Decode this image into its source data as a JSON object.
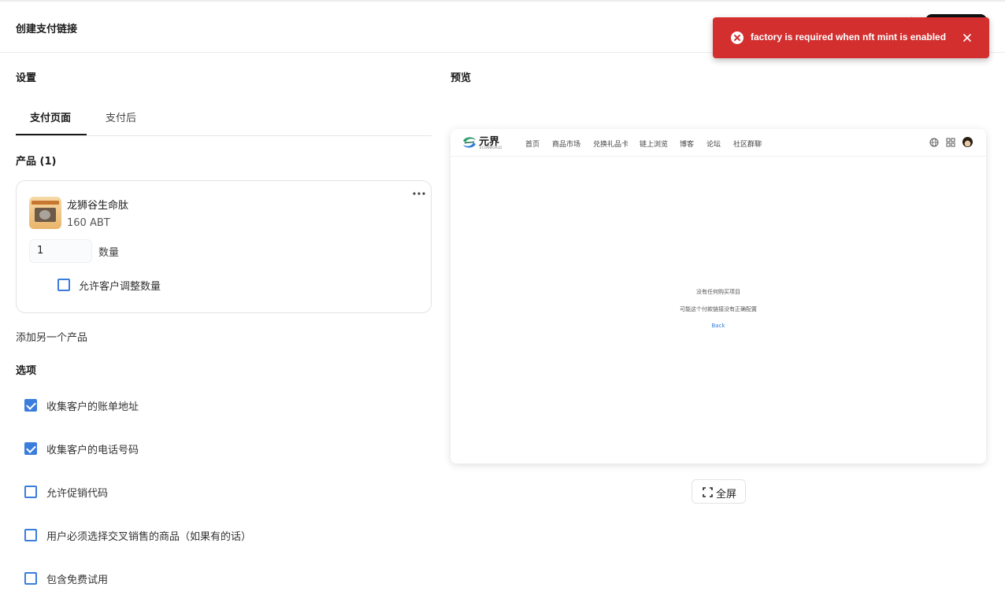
{
  "header": {
    "title": "创建支付链接"
  },
  "toast": {
    "message": "factory is required when nft mint is enabled",
    "color": "#d32f2f"
  },
  "settings": {
    "title": "设置",
    "tabs": [
      {
        "label": "支付页面",
        "active": true
      },
      {
        "label": "支付后",
        "active": false
      }
    ],
    "products_title": "产品 (1)",
    "product": {
      "name": "龙狮谷生命肽",
      "price": "160 ABT",
      "quantity": "1",
      "quantity_label": "数量",
      "allow_adjust_label": "允许客户调整数量",
      "allow_adjust_checked": false
    },
    "add_product": "添加另一个产品",
    "options_title": "选项",
    "options": [
      {
        "label": "收集客户的账单地址",
        "checked": true
      },
      {
        "label": "收集客户的电话号码",
        "checked": true
      },
      {
        "label": "允许促销代码",
        "checked": false
      },
      {
        "label": "用户必须选择交叉销售的商品（如果有的话）",
        "checked": false
      },
      {
        "label": "包含免费试用",
        "checked": false
      }
    ]
  },
  "preview": {
    "title": "预览",
    "logo_text": "元界",
    "logo_sub": "ECONWORLD",
    "nav": [
      "首页",
      "商品市场",
      "兑换礼品卡",
      "链上浏览",
      "博客",
      "论坛",
      "社区群聊"
    ],
    "empty_title": "没有任何购买项目",
    "empty_desc": "可能这个付款链接没有正确配置",
    "back": "Back",
    "fullscreen": "全屏"
  },
  "colors": {
    "accent": "#3b7ddd",
    "link": "#2f7bd9"
  }
}
